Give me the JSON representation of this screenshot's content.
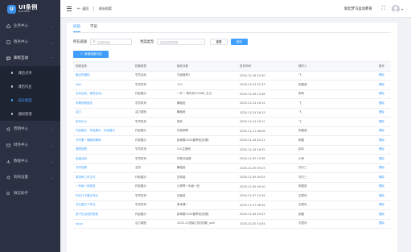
{
  "sidebar": {
    "logo_mark": "U",
    "logo_title": "UI条例",
    "logo_sub": "MATCHBOX",
    "menu": [
      {
        "label": "业务中心",
        "icon": "home-icon",
        "open": false
      },
      {
        "label": "教务中心",
        "icon": "book-icon",
        "open": false
      },
      {
        "label": "家校互动",
        "icon": "chat-icon",
        "open": true
      }
    ],
    "submenu": [
      {
        "label": "课后点评",
        "active": false
      },
      {
        "label": "课后作业",
        "active": false
      },
      {
        "label": "成长档案",
        "active": true
      },
      {
        "label": "通知管理",
        "active": false
      }
    ],
    "menu_after": [
      {
        "label": "营销中心",
        "icon": "megaphone-icon"
      },
      {
        "label": "财务中心",
        "icon": "wallet-icon"
      },
      {
        "label": "数据中心",
        "icon": "chart-icon"
      },
      {
        "label": "机构设置",
        "icon": "gear-icon"
      },
      {
        "label": "微信助手",
        "icon": "wechat-icon"
      }
    ]
  },
  "header": {
    "back_label": "返回",
    "page_name": "成长档案",
    "school_name": "湖北梦马运动教育",
    "fullscreen_icon": "fullscreen-icon"
  },
  "tabs": [
    {
      "label": "班级",
      "active": true
    },
    {
      "label": "学员",
      "active": false
    }
  ],
  "filters": {
    "class_label": "所在班级",
    "class_placeholder": "请选择班级",
    "type_label": "档案类型",
    "type_placeholder": "请选择档案类型",
    "reset_label": "重置",
    "search_label": "查询"
  },
  "add_button_label": "新增档案内容",
  "table": {
    "headers": [
      "档案名称",
      "档案类型",
      "接收对象",
      "发布时间",
      "操作人",
      "操作"
    ],
    "rows": [
      [
        "最近的通知",
        "学员活动",
        "中级篮球2",
        "2020-12-26 22:30",
        "飞",
        "删除"
      ],
      [
        "ddd",
        "学员风采",
        "123",
        "2020-12-24 22:33",
        "宋建强",
        "删除"
      ],
      [
        "文化活动，家校互动。",
        "作品展示",
        "一升一 周年庆2020年_五五",
        "2020-11-26 13:46",
        "宋莉",
        "删除"
      ],
      [
        "学期成绩报告",
        "学员风采",
        "舞蹈班",
        "2020-11-24 16:14",
        "飞",
        "删除"
      ],
      [
        "活力",
        "活力课堂",
        "舞蹈班",
        "2020-11-24 16:13",
        "飞",
        "删除"
      ],
      [
        "秒杀头公",
        "学员风采",
        "猫号",
        "2020-11-24 16:11",
        "飞",
        "删除"
      ],
      [
        "作品展示，作品展示，作品展示",
        "作品展示",
        "花样钢琴",
        "2020-11-21 08:06",
        "宋建强",
        "删除"
      ],
      [
        "开学第一课精彩瞬间",
        "作品展示",
        "新单第2020春季班(班课)",
        "2020-11-16 20:11",
        "杨建",
        "删除"
      ],
      [
        "课堂回顾",
        "学员风采",
        "LOL主播班",
        "2020-11-16 16:32",
        "赵军",
        "删除"
      ],
      [
        "班级活动",
        "学员风采",
        "体育分组课",
        "2020-11-09 10:38",
        "小林",
        "删除"
      ],
      [
        "开学回顾",
        "全员",
        "舞蹈班",
        "2020-11-09 09:23",
        "刘万三",
        "删除"
      ],
      [
        "周末和三年生长",
        "作品展示",
        "四年级",
        "2020-11-09 09:24",
        "刘万三",
        "删除"
      ],
      [
        "一年级一班获奖",
        "作品展示",
        "大提琴一年级一班",
        "2020-11-09 09:10",
        "宋建强",
        "删除"
      ],
      [
        "作业打卡展示作业",
        "学员风采",
        "初级班",
        "2020-11-07 10:34",
        "文君伟",
        "删除"
      ],
      [
        "作业展示了作业",
        "学员风采",
        "美术课一",
        "2020-11-07 08:44",
        "文君伟",
        "删除"
      ],
      [
        "孩子在活动的表现",
        "作品展示",
        "新单第2020春季班(班课)",
        "2020-11-06 20:23",
        "杨建",
        "删除"
      ],
      [
        "aqua",
        "活力课堂",
        "2020-12班级汇报(班课)_so0l",
        "2020-10-30 10:54",
        "文君伟",
        "删除"
      ]
    ]
  },
  "colors": {
    "sidebar_bg": "#2b3143",
    "accent": "#409eff"
  }
}
